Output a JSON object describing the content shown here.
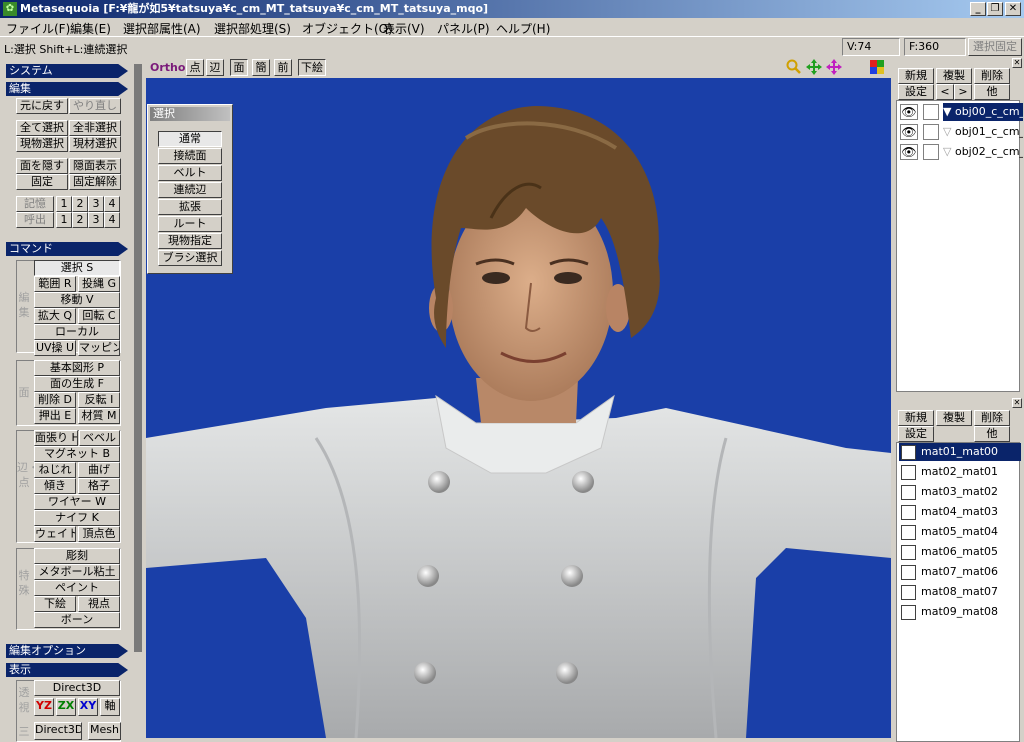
{
  "titlebar": {
    "title": "Metasequoia [F:¥龍が如5¥tatsuya¥c_cm_MT_tatsuya¥c_cm_MT_tatsuya_mqo]",
    "minimize": "_",
    "restore": "❐",
    "close": "✕"
  },
  "menu": [
    "ファイル(F)",
    "編集(E)",
    "選択部属性(A)",
    "選択部処理(S)",
    "オブジェクト(O)",
    "表示(V)",
    "パネル(P)",
    "ヘルプ(H)"
  ],
  "status": {
    "hint": "L:選択  Shift+L:連続選択",
    "vertices": "V:74",
    "faces": "F:360",
    "fix_selection": "選択固定"
  },
  "left_panel": {
    "system_title": "システム",
    "edit_title": "編集",
    "undo": "元に戻す",
    "redo": "やり直し",
    "select_all": "全て選択",
    "deselect_all": "全非選択",
    "select_current": "現物選択",
    "current_material": "現材選択",
    "hide_faces": "面を隠す",
    "show_hidden": "隠面表示",
    "fix": "固定",
    "unfix": "固定解除",
    "memory": "記憶",
    "recall": "呼出",
    "slots": [
      "1",
      "2",
      "3",
      "4"
    ],
    "command_title": "コマンド",
    "edit_group_label": "編集",
    "select_cmd": "選択 S",
    "range": "範囲 R",
    "lasso": "投縄 G",
    "move": "移動 V",
    "scale": "拡大 Q",
    "rotate": "回転 C",
    "local": "ローカル",
    "uv": "UV操 U",
    "mapping": "マッピング",
    "face_group_label": "面",
    "primitive": "基本図形 P",
    "face_gen": "面の生成 F",
    "delete": "削除 D",
    "flip": "反転 I",
    "extrude": "押出 E",
    "material": "材質 M",
    "edge_group_label": "辺・点",
    "face_tension": "面張り H",
    "bevel": "ベベル",
    "magnet": "マグネット B",
    "twist": "ねじれ",
    "bend": "曲げ",
    "tilt": "傾き",
    "lattice": "格子",
    "wire": "ワイヤー W",
    "knife": "ナイフ K",
    "weight": "ウェイト",
    "vertex_color": "頂点色",
    "special_group_label": "特殊",
    "sculpt": "彫刻",
    "metaball": "メタボール粘土",
    "paint": "ペイント",
    "underlay": "下絵",
    "viewpoint": "視点",
    "bone": "ボーン",
    "edit_option_title": "編集オプション",
    "display_title": "表示",
    "display_group_label": "透視",
    "direct3d": "Direct3D",
    "yz": "YZ",
    "zx": "ZX",
    "xy": "XY",
    "axis": "軸",
    "direct3d2": "Direct3D",
    "mesh": "Mesh",
    "three": "三"
  },
  "viewport": {
    "ortho": "Ortho",
    "point": "点",
    "edge": "辺",
    "face": "面",
    "simple": "簡",
    "front": "前",
    "underlay": "下絵",
    "bg_color": "#1a3fa8"
  },
  "select_panel": {
    "title": "選択",
    "options": [
      "通常",
      "接続面",
      "ベルト",
      "連続辺",
      "拡張",
      "ルート",
      "現物指定",
      "ブラシ選択"
    ]
  },
  "right_panel": {
    "new": "新規",
    "duplicate": "複製",
    "delete": "削除",
    "settings": "設定",
    "prev": "<",
    "next": ">",
    "other": "他",
    "objects": [
      {
        "name": "obj00_c_cm_",
        "selected": true
      },
      {
        "name": "obj01_c_cm_",
        "selected": false
      },
      {
        "name": "obj02_c_cm_",
        "selected": false
      }
    ],
    "mat_new": "新規",
    "mat_duplicate": "複製",
    "mat_delete": "削除",
    "mat_settings": "設定",
    "mat_other": "他",
    "materials": [
      {
        "name": "mat01_mat00",
        "selected": true
      },
      {
        "name": "mat02_mat01",
        "selected": false
      },
      {
        "name": "mat03_mat02",
        "selected": false
      },
      {
        "name": "mat04_mat03",
        "selected": false
      },
      {
        "name": "mat05_mat04",
        "selected": false
      },
      {
        "name": "mat06_mat05",
        "selected": false
      },
      {
        "name": "mat07_mat06",
        "selected": false
      },
      {
        "name": "mat08_mat07",
        "selected": false
      },
      {
        "name": "mat09_mat08",
        "selected": false
      }
    ]
  }
}
